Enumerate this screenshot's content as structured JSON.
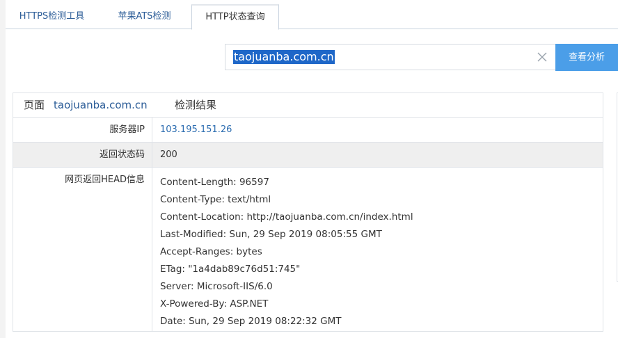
{
  "tabs": [
    {
      "label": "HTTPS检测工具",
      "active": false
    },
    {
      "label": "苹果ATS检测",
      "active": false
    },
    {
      "label": "HTTP状态查询",
      "active": true
    }
  ],
  "search": {
    "value": "taojuanba.com.cn",
    "clear_icon": "close-icon",
    "button_label": "查看分析"
  },
  "result": {
    "header_prefix": "页面",
    "header_domain": "taojuanba.com.cn",
    "header_suffix": "检测结果",
    "rows": {
      "ip": {
        "label": "服务器IP",
        "value": "103.195.151.26"
      },
      "status": {
        "label": "返回状态码",
        "value": "200"
      },
      "head": {
        "label": "网页返回HEAD信息",
        "lines": [
          "Content-Length: 96597",
          "Content-Type: text/html",
          "Content-Location: http://taojuanba.com.cn/index.html",
          "Last-Modified: Sun, 29 Sep 2019 08:05:55 GMT",
          "Accept-Ranges: bytes",
          "ETag: \"1a4dab89c76d51:745\"",
          "Server: Microsoft-IIS/6.0",
          "X-Powered-By: ASP.NET",
          "Date: Sun, 29 Sep 2019 08:22:32 GMT"
        ]
      }
    }
  },
  "colors": {
    "accent": "#4b9ee8",
    "link": "#2b5c97",
    "selection": "#1e67c8"
  }
}
